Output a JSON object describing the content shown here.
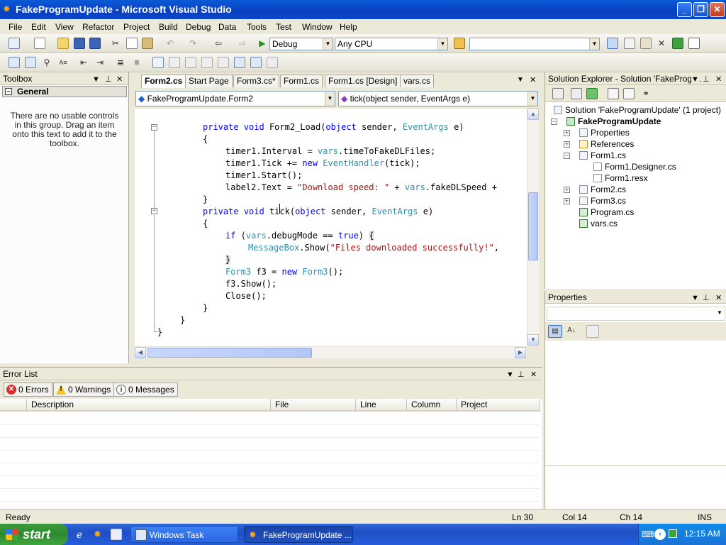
{
  "window": {
    "title": "FakeProgramUpdate - Microsoft Visual Studio"
  },
  "menu": [
    "File",
    "Edit",
    "View",
    "Refactor",
    "Project",
    "Build",
    "Debug",
    "Data",
    "Tools",
    "Test",
    "Window",
    "Help"
  ],
  "toolbar": {
    "config": "Debug",
    "platform": "Any CPU",
    "find": ""
  },
  "toolbox": {
    "title": "Toolbox",
    "group": "General",
    "message": "There are no usable controls in this group. Drag an item onto this text to add it to the toolbox."
  },
  "editor": {
    "tabs": [
      "Form2.cs",
      "Start Page",
      "Form3.cs*",
      "Form1.cs",
      "Form1.cs [Design]",
      "vars.cs"
    ],
    "class_combo": "FakeProgramUpdate.Form2",
    "member_combo": "tick(object sender, EventArgs e)"
  },
  "errorlist": {
    "title": "Error List",
    "errors": "0 Errors",
    "warnings": "0 Warnings",
    "messages": "0 Messages",
    "columns": [
      "Description",
      "File",
      "Line",
      "Column",
      "Project"
    ]
  },
  "solution": {
    "title": "Solution Explorer - Solution 'FakeProgr...",
    "items": [
      "Solution 'FakeProgramUpdate' (1 project)",
      "FakeProgramUpdate",
      "Properties",
      "References",
      "Form1.cs",
      "Form1.Designer.cs",
      "Form1.resx",
      "Form2.cs",
      "Form3.cs",
      "Program.cs",
      "vars.cs"
    ]
  },
  "properties": {
    "title": "Properties"
  },
  "status": {
    "ready": "Ready",
    "ln": "Ln 30",
    "col": "Col 14",
    "ch": "Ch 14",
    "ins": "INS"
  },
  "taskbar": {
    "start": "start",
    "task1": "Windows Task Manager",
    "task2": "FakeProgramUpdate ...",
    "clock": "12:15 AM"
  },
  "colors": {
    "keyword": "#0000ff",
    "type": "#2b91af",
    "string": "#a31515",
    "titlebar": "#0a4cc9"
  }
}
